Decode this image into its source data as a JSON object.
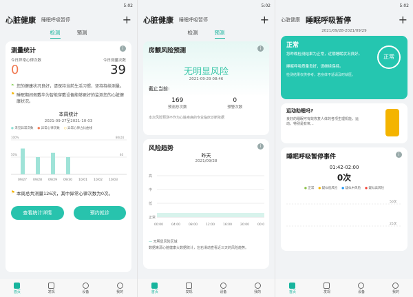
{
  "time": "5:02",
  "screen1": {
    "title": "心脏健康",
    "subtitle": "睡眠呼吸暂停",
    "tabs": [
      "检测",
      "预测"
    ],
    "stat_title": "测量统计",
    "abn_label": "今日异常心律次数",
    "abn_value": "0",
    "meas_label": "今日测量次数",
    "meas_value": "39",
    "tip1": "您的健康状况良好，请保持当前生活习惯，坚持持续测量。",
    "tip2": "睡眠期间佩戴华为智能穿戴设备能够更好的监测您的心脏健康状况。",
    "week_title": "本周统计",
    "week_range": "2021-09-27至2021-10-03",
    "legend": [
      "未见异常次数",
      "异常心律次数",
      "异常心律占比曲线"
    ],
    "chart_data": {
      "type": "bar",
      "categories": [
        "09/27",
        "09/28",
        "09/29",
        "09/30",
        "10/01",
        "10/02",
        "10/03"
      ],
      "values": [
        60,
        40,
        50,
        40,
        0,
        0,
        0
      ],
      "y_right": [
        "80(次)",
        "40"
      ],
      "y_left": [
        "100%",
        "50%"
      ]
    },
    "summary": "本周总共测量126次，其中异常心律次数为0次。",
    "btn_detail": "查看统计详情",
    "btn_book": "预约就诊"
  },
  "screen2": {
    "title": "心脏健康",
    "subtitle": "睡眠呼吸暂停",
    "tabs": [
      "检测",
      "预测"
    ],
    "risk_title": "房颤风险预测",
    "risk_result": "无明显风险",
    "risk_time": "2021-09-29 08:46",
    "as_of": "截止当前:",
    "predict_count": "169",
    "predict_label": "预测总次数",
    "warn_count": "0",
    "warn_label": "预警次数",
    "disclaimer": "本次风险预测不作为心脏疾病的专业临床诊断依据",
    "trend_title": "风险趋势",
    "trend_day": "昨天",
    "trend_date": "2021/09/28",
    "levels": [
      "高",
      "中",
      "低",
      "正常"
    ],
    "x_labels": [
      "00:00",
      "04:00",
      "08:00",
      "12:00",
      "16:00",
      "20:00",
      "00:00"
    ],
    "legend1": "无明显风险区域",
    "note": "数据来源心脏健康大数据统计，左右滑动查看近三天的风险趋势。"
  },
  "screen3": {
    "title": "心脏健康",
    "subtitle": "睡眠呼吸暂停",
    "date_range": "2021/09/28-2021/09/29",
    "status_title": "正常",
    "status_badge": "正常",
    "status_text": "您昨晚检测结果为正常，近期睡眠状况良好。",
    "status_tip": "睡眠呼吸质量良好，请继续保持。",
    "status_disclaimer": "检测结果仅供参考，若身体不适请及时就医。",
    "promo_title": "运动助眠吗?",
    "promo_text": "良好的睡眠可有效恢复人体的各项生理机能，运动，特别是有氧...",
    "event_title": "睡眠呼吸暂停事件",
    "event_time": "01:42-02:00",
    "event_count": "0次",
    "event_legend": [
      "正常",
      "疑似低风险",
      "疑似中风险",
      "疑似高风险"
    ],
    "y_labels": [
      "50次",
      "25次"
    ]
  },
  "nav": [
    "首页",
    "发现",
    "设备",
    "我的"
  ]
}
